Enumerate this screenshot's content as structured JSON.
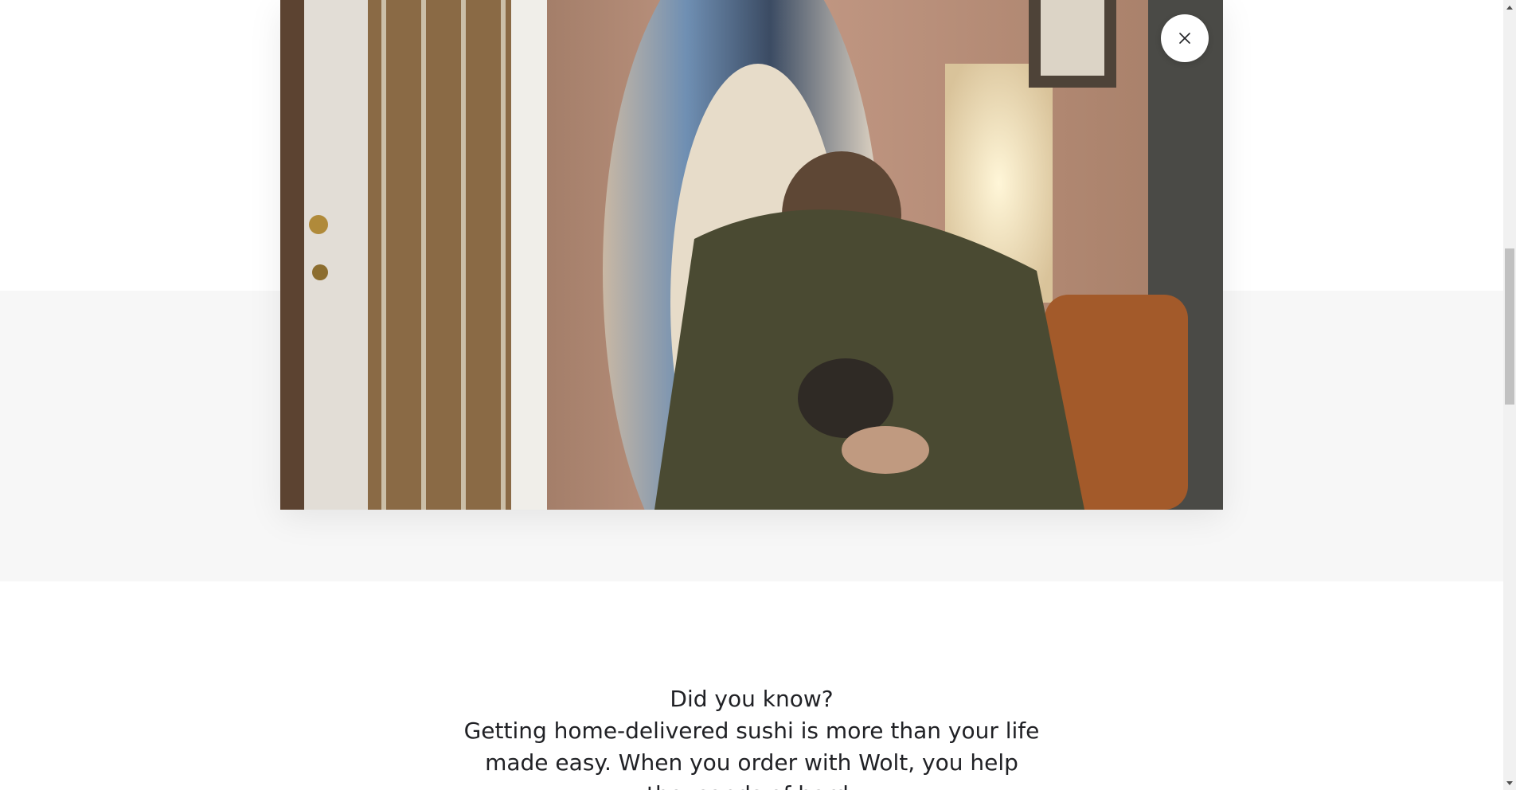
{
  "modal": {
    "close_icon": "close-icon",
    "video_description_icon": "video-frame"
  },
  "article": {
    "heading": "Did you know?",
    "body": "Getting home-delivered sushi is more than your life made easy. When you order with Wolt, you help thousands of hard-"
  },
  "colors": {
    "page_background": "#ffffff",
    "band_background": "#f7f7f7",
    "text": "#202125"
  }
}
